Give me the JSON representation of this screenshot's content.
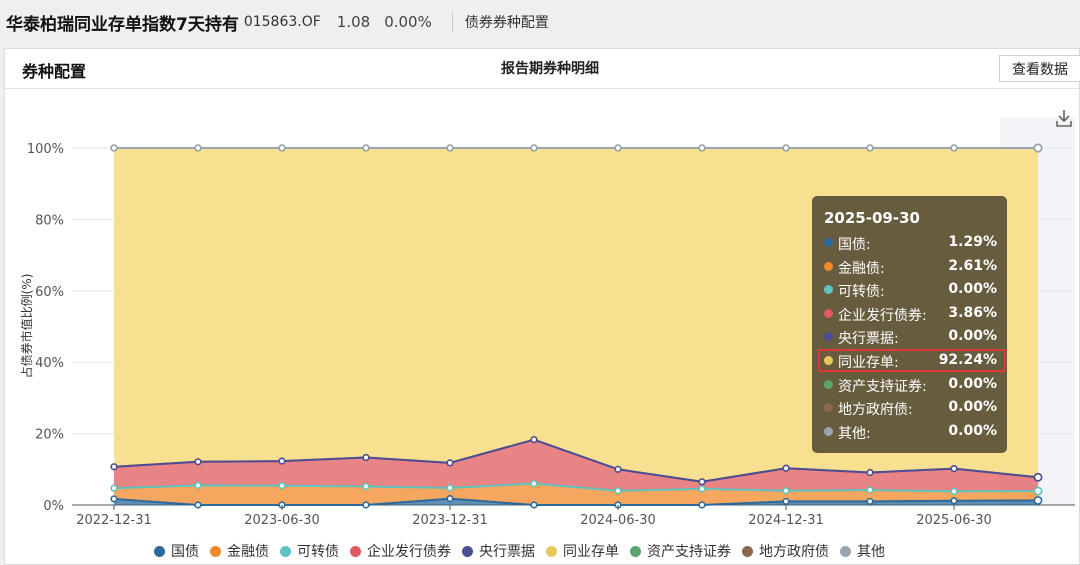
{
  "header": {
    "fund_name": "华泰柏瑞同业存单指数7天持有",
    "fund_code": "015863.OF",
    "nav": "1.08",
    "change": "0.00%",
    "section": "债券券种配置"
  },
  "panel": {
    "title": "券种配置",
    "view_button": "查看数据"
  },
  "colors": {
    "国债": "#2b6a9b",
    "金融债": "#f28a2a",
    "可转债": "#5fc3c3",
    "企业发行债券": "#e05a5e",
    "央行票据": "#4a4f95",
    "同业存单": "#e8c95c",
    "资产支持证券": "#5ca36e",
    "地方政府债": "#8a6a4e",
    "其他": "#9aa5b0"
  },
  "chart_data": {
    "type": "area",
    "stacked": true,
    "title": "报告期券种明细",
    "ylabel": "占债券市值比例(%)",
    "xlabel": "",
    "ylim": [
      0,
      100
    ],
    "yticks": [
      "0%",
      "20%",
      "40%",
      "60%",
      "80%",
      "100%"
    ],
    "x": [
      "2022-12-31",
      "2023-03-31",
      "2023-06-30",
      "2023-09-30",
      "2023-12-31",
      "2024-03-31",
      "2024-06-30",
      "2024-09-30",
      "2024-12-31",
      "2025-03-31",
      "2025-06-30",
      "2025-09-30"
    ],
    "xtick_labels": [
      "2022-12-31",
      "2023-06-30",
      "2023-12-31",
      "2024-06-30",
      "2024-12-31",
      "2025-06-30"
    ],
    "series": [
      {
        "name": "国债",
        "values": [
          1.7,
          0.0,
          0.0,
          0.0,
          1.8,
          0.0,
          0.0,
          0.0,
          1.0,
          1.0,
          1.2,
          1.29
        ]
      },
      {
        "name": "金融债",
        "values": [
          3.0,
          5.5,
          5.4,
          5.2,
          3.0,
          6.0,
          4.0,
          4.5,
          3.0,
          3.2,
          2.6,
          2.61
        ]
      },
      {
        "name": "可转债",
        "values": [
          0,
          0,
          0,
          0,
          0,
          0,
          0,
          0,
          0,
          0,
          0,
          0.0
        ]
      },
      {
        "name": "企业发行债券",
        "values": [
          6.0,
          6.6,
          6.9,
          8.1,
          7.0,
          12.3,
          6.0,
          2.0,
          6.3,
          4.9,
          6.4,
          3.86
        ]
      },
      {
        "name": "央行票据",
        "values": [
          0,
          0,
          0,
          0,
          0,
          0,
          0,
          0,
          0,
          0,
          0,
          0.0
        ]
      },
      {
        "name": "同业存单",
        "values": [
          89.3,
          87.9,
          87.7,
          86.7,
          88.2,
          81.7,
          90.0,
          93.5,
          89.7,
          90.9,
          89.8,
          92.24
        ]
      },
      {
        "name": "资产支持证券",
        "values": [
          0,
          0,
          0,
          0,
          0,
          0,
          0,
          0,
          0,
          0,
          0,
          0.0
        ]
      },
      {
        "name": "地方政府债",
        "values": [
          0,
          0,
          0,
          0,
          0,
          0,
          0,
          0,
          0,
          0,
          0,
          0.0
        ]
      },
      {
        "name": "其他",
        "values": [
          0,
          0,
          0,
          0,
          0,
          0,
          0,
          0,
          0,
          0,
          0,
          0.0
        ]
      }
    ],
    "legend_position": "bottom",
    "grid": true
  },
  "tooltip": {
    "date": "2025-09-30",
    "rows": [
      {
        "name": "国债:",
        "value": "1.29%",
        "key": "国债"
      },
      {
        "name": "金融债:",
        "value": "2.61%",
        "key": "金融债"
      },
      {
        "name": "可转债:",
        "value": "0.00%",
        "key": "可转债"
      },
      {
        "name": "企业发行债券:",
        "value": "3.86%",
        "key": "企业发行债券"
      },
      {
        "name": "央行票据:",
        "value": "0.00%",
        "key": "央行票据"
      },
      {
        "name": "同业存单:",
        "value": "92.24%",
        "key": "同业存单"
      },
      {
        "name": "资产支持证券:",
        "value": "0.00%",
        "key": "资产支持证券"
      },
      {
        "name": "地方政府债:",
        "value": "0.00%",
        "key": "地方政府债"
      },
      {
        "name": "其他:",
        "value": "0.00%",
        "key": "其他"
      }
    ],
    "highlighted": "同业存单"
  },
  "legend": [
    "国债",
    "金融债",
    "可转债",
    "企业发行债券",
    "央行票据",
    "同业存单",
    "资产支持证券",
    "地方政府债",
    "其他"
  ]
}
